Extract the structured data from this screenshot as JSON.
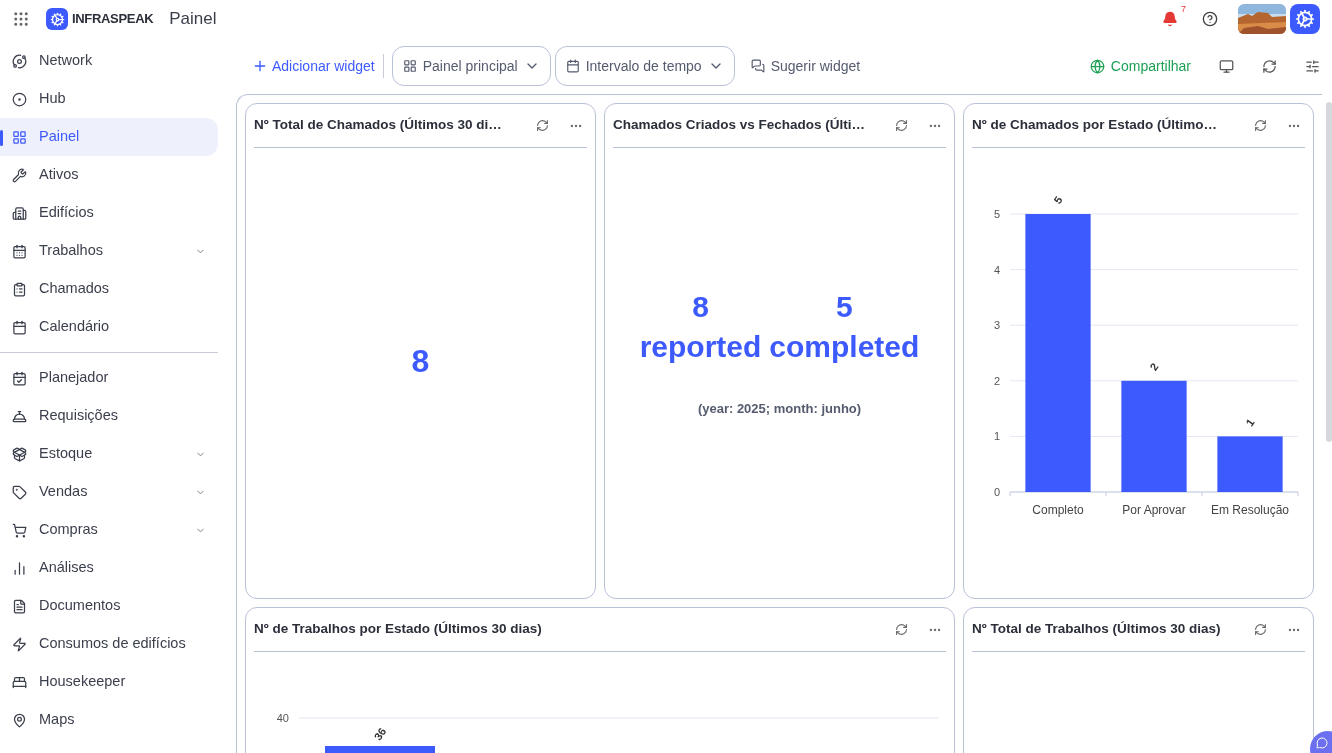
{
  "header": {
    "brand": "INFRASPEAK",
    "page_title": "Painel",
    "notifications": {
      "count": "7"
    }
  },
  "sidebar": {
    "groups": [
      [
        {
          "label": "Network",
          "selected": false,
          "expandable": false
        },
        {
          "label": "Hub",
          "selected": false,
          "expandable": false
        },
        {
          "label": "Painel",
          "selected": true,
          "expandable": false
        },
        {
          "label": "Ativos",
          "selected": false,
          "expandable": false
        },
        {
          "label": "Edifícios",
          "selected": false,
          "expandable": false
        },
        {
          "label": "Trabalhos",
          "selected": false,
          "expandable": true
        },
        {
          "label": "Chamados",
          "selected": false,
          "expandable": false
        },
        {
          "label": "Calendário",
          "selected": false,
          "expandable": false
        }
      ],
      [
        {
          "label": "Planejador",
          "selected": false,
          "expandable": false
        },
        {
          "label": "Requisições",
          "selected": false,
          "expandable": false
        },
        {
          "label": "Estoque",
          "selected": false,
          "expandable": true
        },
        {
          "label": "Vendas",
          "selected": false,
          "expandable": true
        },
        {
          "label": "Compras",
          "selected": false,
          "expandable": true
        },
        {
          "label": "Análises",
          "selected": false,
          "expandable": false
        },
        {
          "label": "Documentos",
          "selected": false,
          "expandable": false
        },
        {
          "label": "Consumos de edifícios",
          "selected": false,
          "expandable": false
        },
        {
          "label": "Housekeeper",
          "selected": false,
          "expandable": false
        },
        {
          "label": "Maps",
          "selected": false,
          "expandable": false
        }
      ]
    ]
  },
  "toolbar": {
    "add_widget": "Adicionar widget",
    "dashboard_select": "Painel principal",
    "time_range_select": "Intervalo de tempo",
    "suggest": "Sugerir widget",
    "share": "Compartilhar"
  },
  "widgets": [
    {
      "kind": "number",
      "title": "Nº Total de Chamados (Últimos 30 di…",
      "value": "8"
    },
    {
      "kind": "comparison",
      "title": "Chamados Criados vs Fechados (Últi…",
      "stats": [
        {
          "value": "8",
          "label": "reported"
        },
        {
          "value": "5",
          "label": "completed"
        }
      ],
      "note": "(year: 2025; month: junho)"
    },
    {
      "kind": "chart",
      "title": "Nº de Chamados por Estado (Último…",
      "chart_data": {
        "type": "bar",
        "categories": [
          "Completo",
          "Por Aprovar",
          "Em Resolução"
        ],
        "series": [
          {
            "color": "#3d5afe",
            "values": [
              5,
              2,
              1
            ]
          }
        ],
        "ylim": [
          0,
          5
        ],
        "yticks": [
          0,
          1,
          2,
          3,
          4,
          5
        ],
        "grid": true,
        "data_labels": true
      }
    },
    {
      "kind": "bar_preview",
      "title": "Nº de Trabalhos por Estado (Últimos 30 dias)",
      "tick_label": "40",
      "bar_label": "36"
    },
    {
      "kind": "empty",
      "title": "Nº Total de Trabalhos (Últimos 30 dias)"
    }
  ]
}
